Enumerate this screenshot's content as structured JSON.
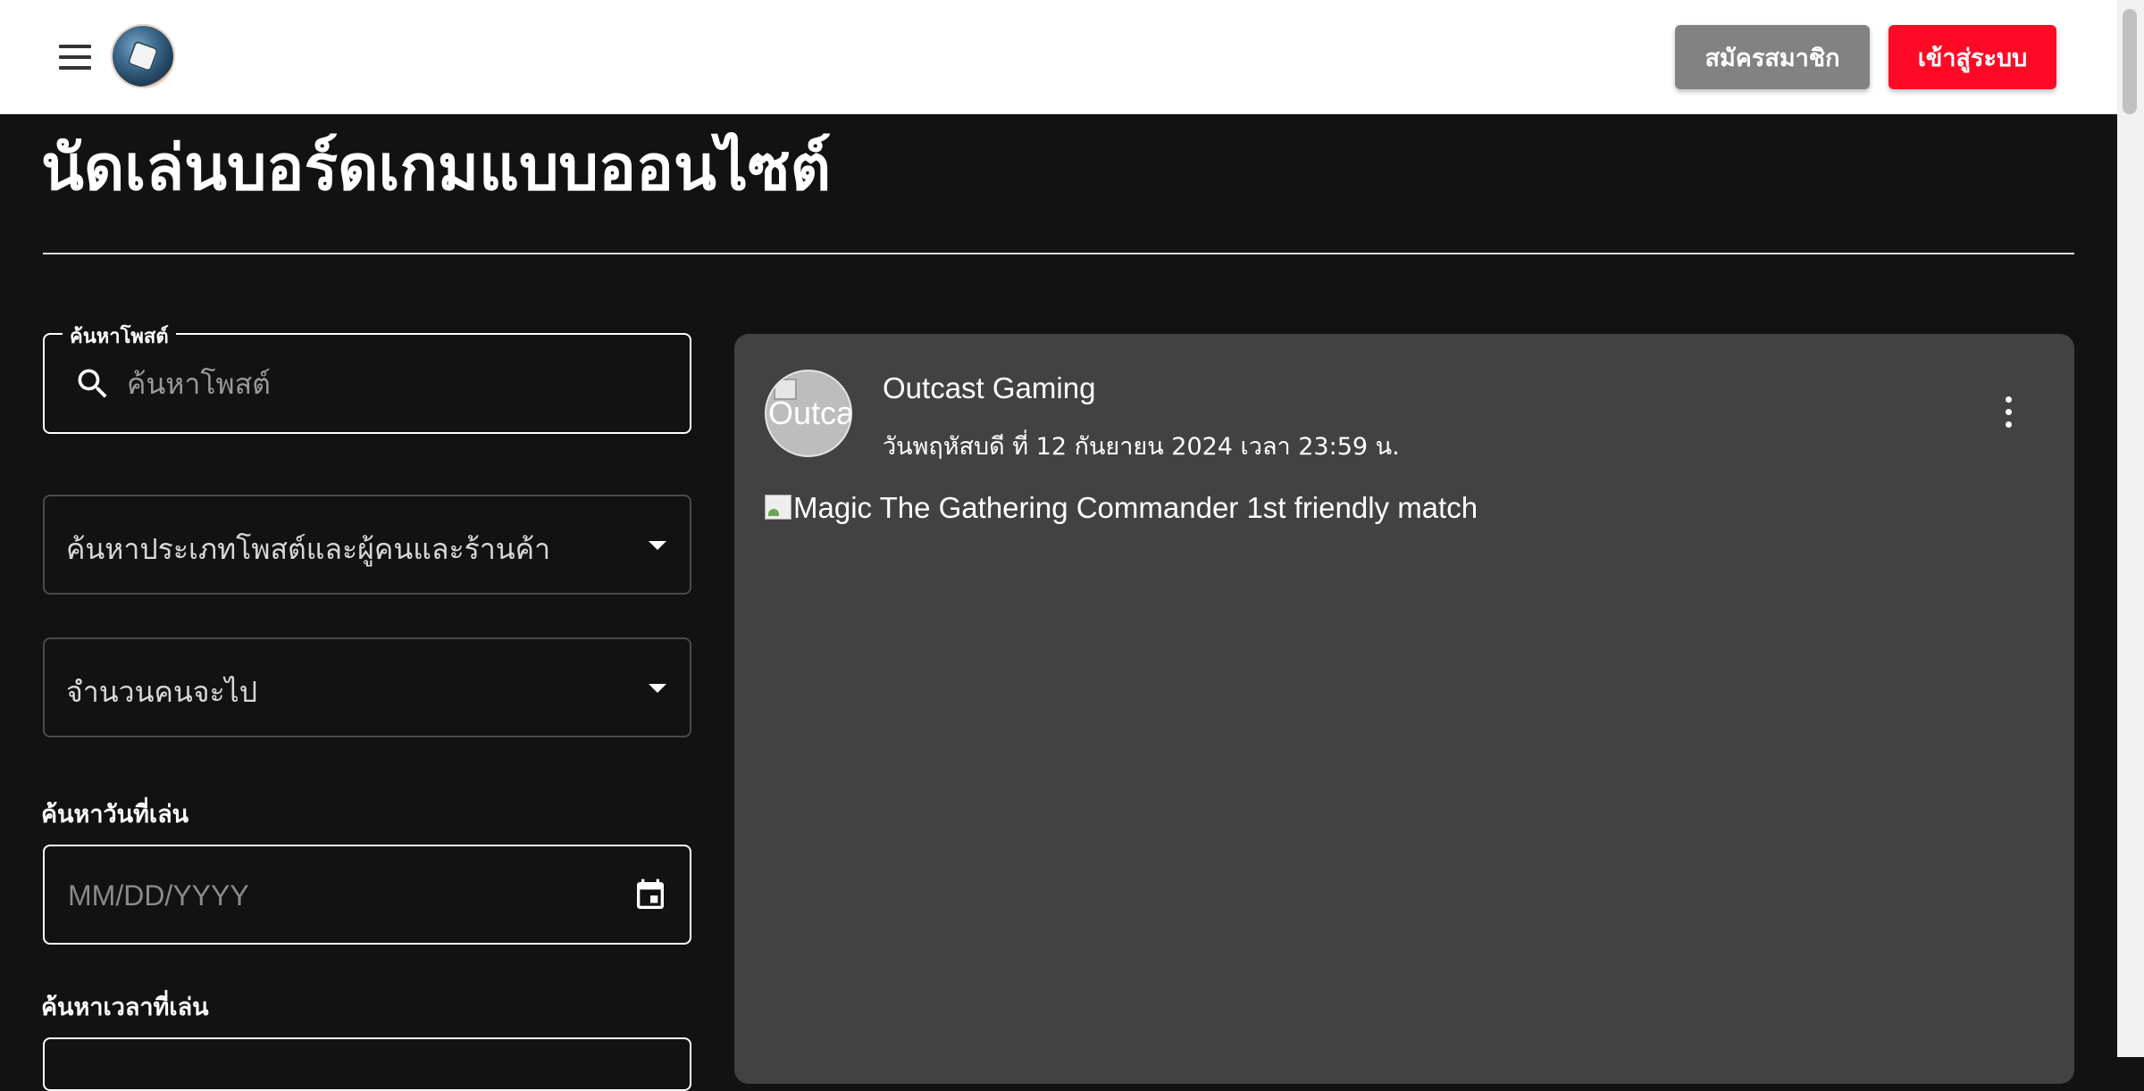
{
  "header": {
    "menu_icon": "hamburger-menu-icon",
    "logo": "dice-logo",
    "register_label": "สมัครสมาชิก",
    "login_label": "เข้าสู่ระบบ",
    "register_color": "#828282",
    "login_color": "#ff0a26"
  },
  "page": {
    "title": "นัดเล่นบอร์ดเกมแบบออนไซต์"
  },
  "filters": {
    "search": {
      "legend": "ค้นหาโพสต์",
      "placeholder": "ค้นหาโพสต์",
      "icon": "search-icon"
    },
    "type_select": {
      "value": "ค้นหาประเภทโพสต์และผู้คนและร้านค้า",
      "icon": "arrow-drop-down-icon"
    },
    "people_select": {
      "value": "จำนวนคนจะไป",
      "icon": "arrow-drop-down-icon"
    },
    "date": {
      "label": "ค้นหาวันที่เล่น",
      "placeholder": "MM/DD/YYYY",
      "icon": "calendar-icon"
    },
    "time": {
      "label": "ค้นหาเวลาที่เล่น"
    }
  },
  "post": {
    "avatar_alt": "Outcast Gaming",
    "author": "Outcast Gaming",
    "date": "วันพฤหัสบดี ที่ 12 กันยายน 2024 เวลา 23:59 น.",
    "image_alt": "Magic The Gathering Commander 1st friendly match",
    "more_icon": "more-vert-icon"
  }
}
